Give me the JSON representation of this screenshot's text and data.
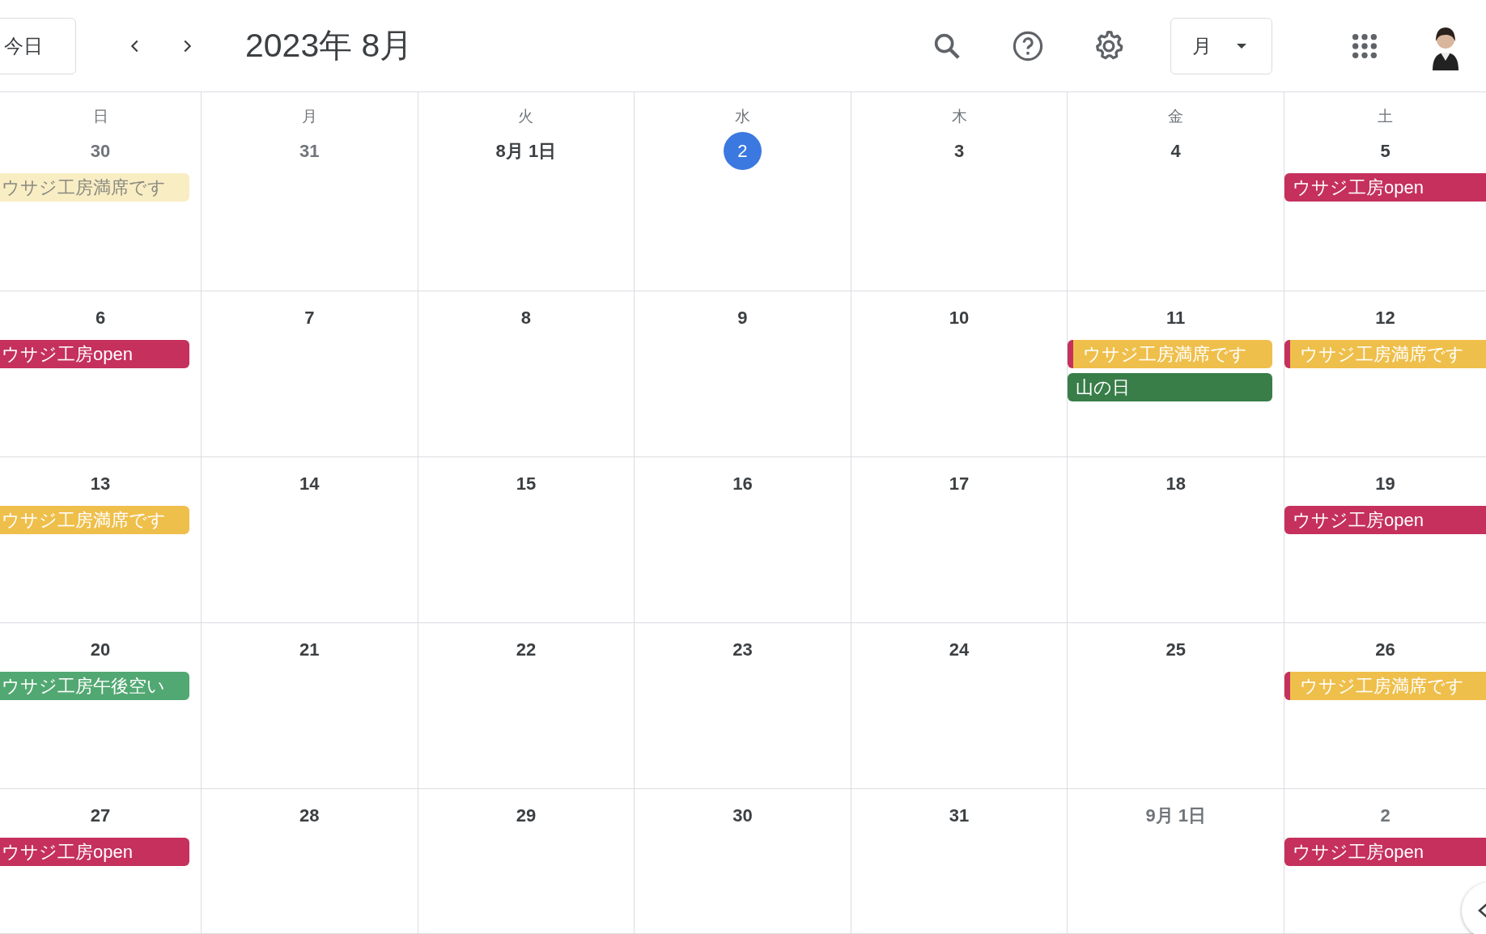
{
  "toolbar": {
    "today_button": "今日",
    "title": "2023年 8月",
    "view_dropdown": "月"
  },
  "weekdays": [
    "日",
    "月",
    "火",
    "水",
    "木",
    "金",
    "土"
  ],
  "weeks": [
    [
      {
        "label": "30",
        "muted": true,
        "today": false,
        "events": [
          {
            "title": "ウサジ工房満席です",
            "kind": "past",
            "color": "#f9edc4"
          }
        ]
      },
      {
        "label": "31",
        "muted": true,
        "today": false
      },
      {
        "label": "8月 1日",
        "muted": false,
        "today": false
      },
      {
        "label": "2",
        "muted": false,
        "today": true
      },
      {
        "label": "3",
        "muted": false,
        "today": false
      },
      {
        "label": "4",
        "muted": false,
        "today": false
      },
      {
        "label": "5",
        "muted": false,
        "today": false,
        "events": [
          {
            "title": "ウサジ工房open",
            "kind": "solid",
            "color": "#c5305d"
          }
        ]
      }
    ],
    [
      {
        "label": "6",
        "muted": false,
        "today": false,
        "events": [
          {
            "title": "ウサジ工房open",
            "kind": "solid",
            "color": "#c5305d"
          }
        ]
      },
      {
        "label": "7",
        "muted": false,
        "today": false
      },
      {
        "label": "8",
        "muted": false,
        "today": false
      },
      {
        "label": "9",
        "muted": false,
        "today": false
      },
      {
        "label": "10",
        "muted": false,
        "today": false
      },
      {
        "label": "11",
        "muted": false,
        "today": false,
        "events": [
          {
            "title": "ウサジ工房満席です",
            "kind": "marked",
            "color": "#efbf4b"
          },
          {
            "title": "山の日",
            "kind": "solid",
            "color": "#397d49"
          }
        ]
      },
      {
        "label": "12",
        "muted": false,
        "today": false,
        "events": [
          {
            "title": "ウサジ工房満席です",
            "kind": "marked",
            "color": "#efbf4b"
          }
        ]
      }
    ],
    [
      {
        "label": "13",
        "muted": false,
        "today": false,
        "events": [
          {
            "title": "ウサジ工房満席です",
            "kind": "solid",
            "color": "#efbf4b"
          }
        ]
      },
      {
        "label": "14",
        "muted": false,
        "today": false
      },
      {
        "label": "15",
        "muted": false,
        "today": false
      },
      {
        "label": "16",
        "muted": false,
        "today": false
      },
      {
        "label": "17",
        "muted": false,
        "today": false
      },
      {
        "label": "18",
        "muted": false,
        "today": false
      },
      {
        "label": "19",
        "muted": false,
        "today": false,
        "events": [
          {
            "title": "ウサジ工房open",
            "kind": "solid",
            "color": "#c5305d"
          }
        ]
      }
    ],
    [
      {
        "label": "20",
        "muted": false,
        "today": false,
        "events": [
          {
            "title": "ウサジ工房午後空い",
            "kind": "solid",
            "color": "#52a872"
          }
        ]
      },
      {
        "label": "21",
        "muted": false,
        "today": false
      },
      {
        "label": "22",
        "muted": false,
        "today": false
      },
      {
        "label": "23",
        "muted": false,
        "today": false
      },
      {
        "label": "24",
        "muted": false,
        "today": false
      },
      {
        "label": "25",
        "muted": false,
        "today": false
      },
      {
        "label": "26",
        "muted": false,
        "today": false,
        "events": [
          {
            "title": "ウサジ工房満席です",
            "kind": "marked",
            "color": "#efbf4b"
          }
        ]
      }
    ],
    [
      {
        "label": "27",
        "muted": false,
        "today": false,
        "events": [
          {
            "title": "ウサジ工房open",
            "kind": "solid",
            "color": "#c5305d"
          }
        ]
      },
      {
        "label": "28",
        "muted": false,
        "today": false
      },
      {
        "label": "29",
        "muted": false,
        "today": false
      },
      {
        "label": "30",
        "muted": false,
        "today": false
      },
      {
        "label": "31",
        "muted": false,
        "today": false
      },
      {
        "label": "9月 1日",
        "muted": true,
        "today": false
      },
      {
        "label": "2",
        "muted": true,
        "today": false,
        "events": [
          {
            "title": "ウサジ工房open",
            "kind": "solid",
            "color": "#c5305d"
          }
        ]
      }
    ]
  ]
}
